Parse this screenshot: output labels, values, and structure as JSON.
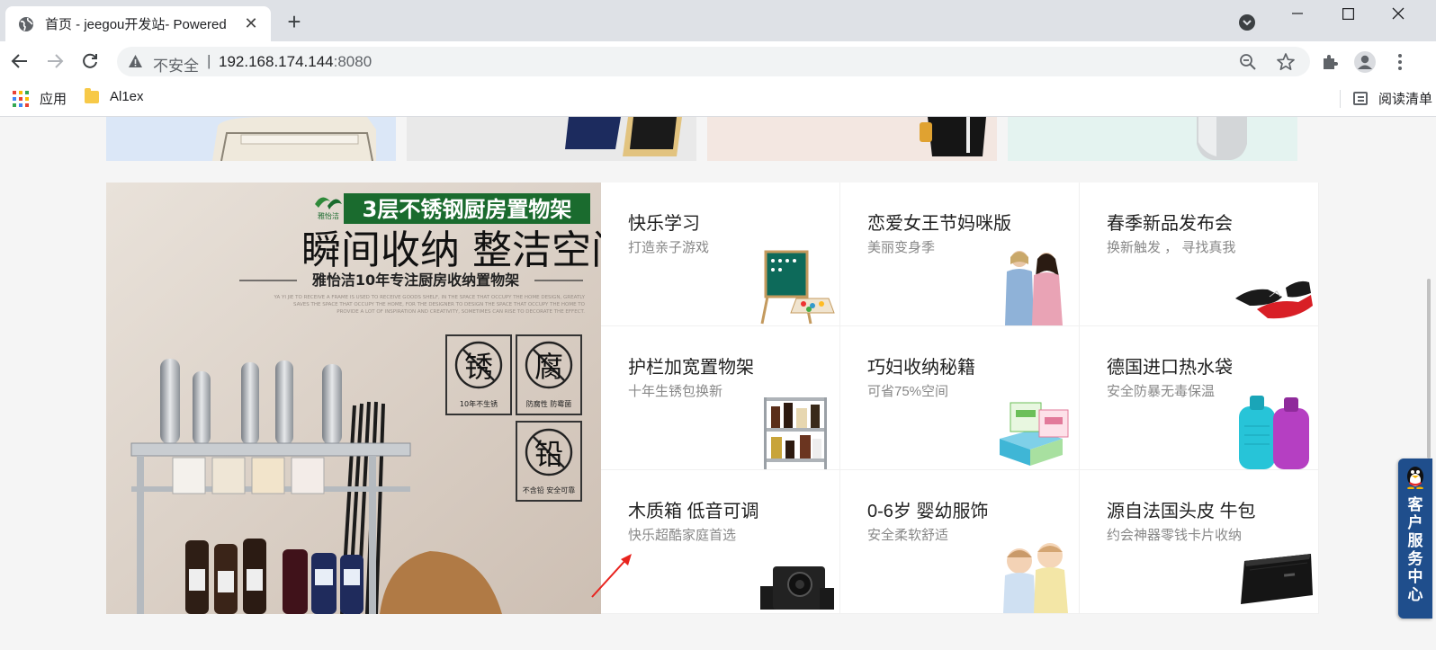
{
  "browser": {
    "tab_title": "首页 - jeegou开发站- Powered",
    "address": {
      "security_label": "不安全",
      "separator": "|",
      "host": "192.168.174.144",
      "port": ":8080"
    },
    "bookmarks": [
      {
        "label": "应用",
        "icon": "apps-grid-icon"
      },
      {
        "label": "Al1ex",
        "icon": "folder-icon"
      }
    ],
    "reading_list": "阅读清单"
  },
  "product_grid": [
    {
      "title": "快乐学习",
      "subtitle": "打造亲子游戏",
      "icon": "easel-board-icon"
    },
    {
      "title": "恋爱女王节妈咪版",
      "subtitle": "美丽变身季",
      "icon": "mother-daughter-photo"
    },
    {
      "title": "春季新品发布会",
      "subtitle": "换新触发 ， 寻找真我",
      "icon": "red-shoes-photo"
    },
    {
      "title": "护栏加宽置物架",
      "subtitle": "十年生锈包换新",
      "icon": "shelf-rack-photo"
    },
    {
      "title": "巧妇收纳秘籍",
      "subtitle": "可省75%空间",
      "icon": "storage-boxes-photo"
    },
    {
      "title": "德国进口热水袋",
      "subtitle": "安全防暴无毒保温",
      "icon": "hot-water-bottle-photo"
    },
    {
      "title": "木质箱 低音可调",
      "subtitle": "快乐超酷家庭首选",
      "icon": "speaker-photo"
    },
    {
      "title": "0-6岁 婴幼服饰",
      "subtitle": "安全柔软舒适",
      "icon": "babies-photo"
    },
    {
      "title": "源自法国头皮 牛包",
      "subtitle": "约会神器零钱卡片收纳",
      "icon": "wallet-photo"
    }
  ],
  "feature_ad": {
    "headline_tag": "3层不锈钢厨房置物架",
    "brand": "雅怡洁",
    "headline": "瞬间收纳  整洁空间",
    "subline": "雅怡洁10年专注厨房收纳置物架",
    "fine_print": "YA YI JIE TO RECEIVE A FRAME IS USED TO RECEIVE GOODS SHELF, IN THE SPACE THAT OCCUPY THE HOME DESIGN, GREATLY SAVES THE SPACE THAT OCCUPY THE HOME, FOR THE DESIGNER TO DESIGN THE SPACE THAT OCCUPY THE HOME TO PROVIDE A LOT OF INSPIRATION AND CREATIVITY, SOMETIMES CAN RISE TO DECORATE THE EFFECT.",
    "badges": [
      {
        "char": "锈",
        "caption": "10年不生锈"
      },
      {
        "char": "腐",
        "caption": "防腐性  防霉菌"
      },
      {
        "char": "铅",
        "caption": "不含铅  安全可靠"
      }
    ]
  },
  "customer_service": {
    "label": "客户服务中心"
  },
  "colors": {
    "brand_green": "#1a6b2e",
    "cs_blue": "#1f4e8c",
    "annotation_arrow": "#e8231e"
  }
}
